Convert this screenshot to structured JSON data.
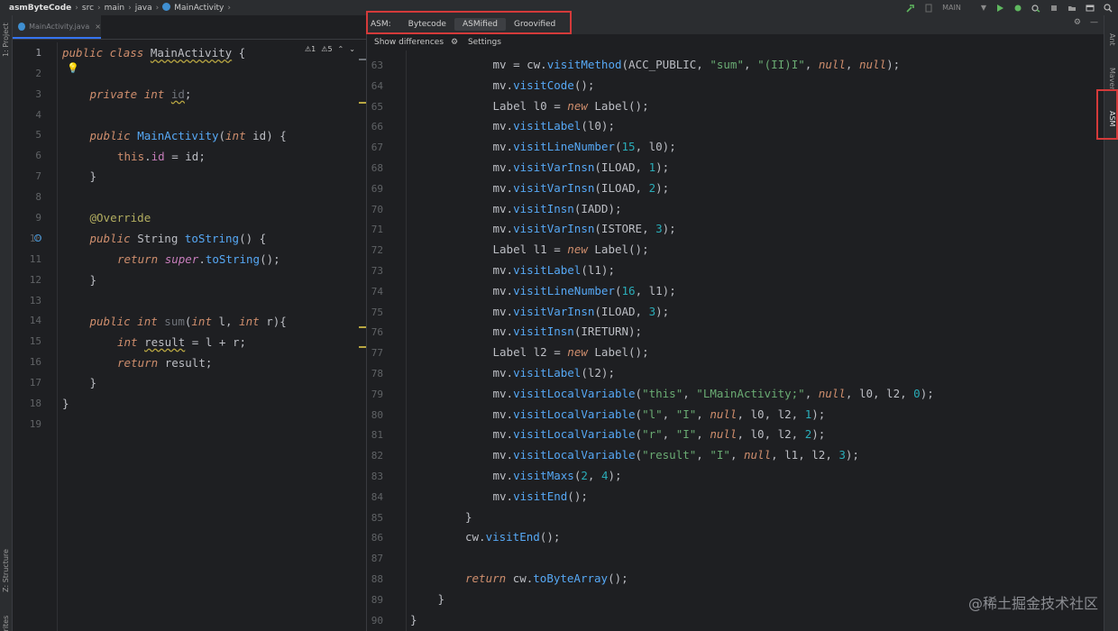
{
  "breadcrumb": [
    "asmByteCode",
    "src",
    "main",
    "java",
    "MainActivity"
  ],
  "toolbar": {
    "run_config": "MAIN",
    "run_config_arrow": "▼"
  },
  "left_strip": {
    "project": "1: Project",
    "structure": "Z: Structure",
    "favorites": "avorites"
  },
  "right_strip": {
    "ant": "Ant",
    "maven": "Maven",
    "asm": "ASM"
  },
  "file_tab": {
    "name": "MainActivity.java",
    "close": "×"
  },
  "inspections": {
    "warnings": "⚠1",
    "weak_warnings": "⚠5",
    "up": "⌃",
    "down": "⌄"
  },
  "left_editor": {
    "line_numbers": [
      "1",
      "2",
      "3",
      "4",
      "5",
      "6",
      "7",
      "8",
      "9",
      "10",
      "11",
      "12",
      "13",
      "14",
      "15",
      "16",
      "17",
      "18",
      "19"
    ]
  },
  "asm_panel": {
    "label": "ASM:",
    "tabs": [
      "Bytecode",
      "ASMified",
      "Groovified"
    ],
    "active_tab": "ASMified",
    "show_differences": "Show differences",
    "settings": "Settings",
    "settings_icon": "gear-icon"
  },
  "right_editor": {
    "line_numbers": [
      "63",
      "64",
      "65",
      "66",
      "67",
      "68",
      "69",
      "70",
      "71",
      "72",
      "73",
      "74",
      "75",
      "76",
      "77",
      "78",
      "79",
      "80",
      "81",
      "82",
      "83",
      "84",
      "85",
      "86",
      "87",
      "88",
      "89",
      "90"
    ]
  },
  "watermark": "@稀土掘金技术社区",
  "colors": {
    "keyword": "#cf8e6d",
    "function": "#56a8f5",
    "string": "#6aab73",
    "number": "#2aacb8",
    "field": "#c77dbb",
    "annotation": "#b3ae60",
    "highlight_box": "#d43a3a"
  }
}
